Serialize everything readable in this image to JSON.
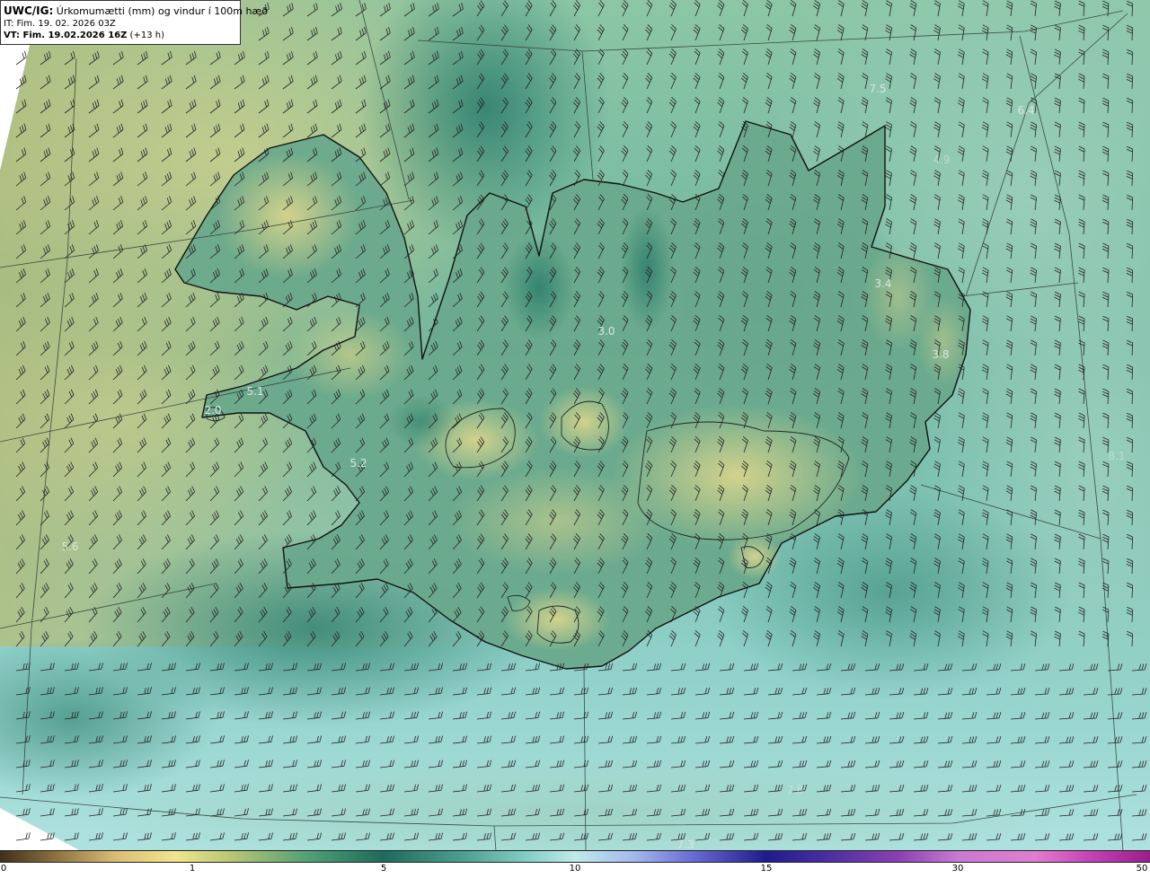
{
  "header": {
    "model": "UWC/IG:",
    "title": " Úrkomumætti (mm) og vindur í 100m hæð",
    "it_line": "IT: Fim. 19. 02. 2026 03Z",
    "vt_prefix": "VT: Fim. 19.02.2026 16Z",
    "vt_suffix": " (+13 h)"
  },
  "labels": [
    {
      "text": "7.5",
      "faint": false
    },
    {
      "text": "6.4",
      "faint": false
    },
    {
      "text": "3.4",
      "faint": false
    },
    {
      "text": "3.0",
      "faint": false
    },
    {
      "text": "3.8",
      "faint": false
    },
    {
      "text": "5.1",
      "faint": false
    },
    {
      "text": "2.0",
      "faint": false
    },
    {
      "text": "5.2",
      "faint": false
    },
    {
      "text": "5.6",
      "faint": false
    },
    {
      "text": "7.3",
      "faint": false
    },
    {
      "text": "4.9",
      "faint": true
    },
    {
      "text": "7.8",
      "faint": true
    },
    {
      "text": "8.1",
      "faint": true
    }
  ],
  "colorbar": {
    "ticks": [
      "0",
      "1",
      "5",
      "10",
      "15",
      "30",
      "50"
    ]
  },
  "colors": {
    "ocean_light": "#a9dcd8",
    "ocean_mid": "#6fb9aa",
    "land_yellow": "#c9c982",
    "land_green": "#4f9a82",
    "coast": "#111111"
  }
}
